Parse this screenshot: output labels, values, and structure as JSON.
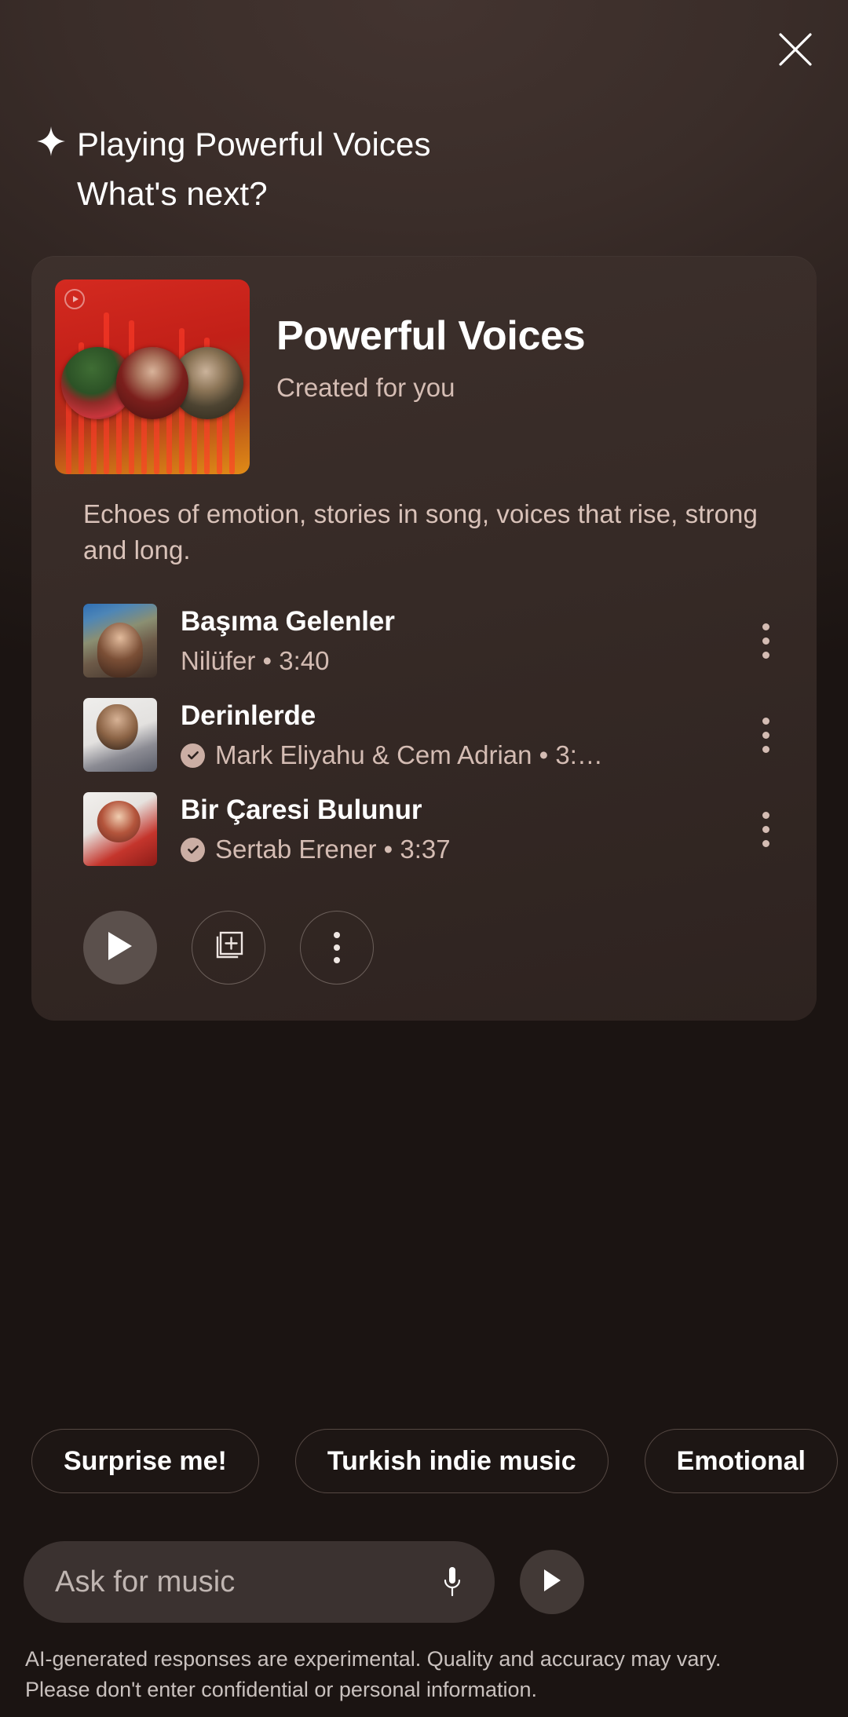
{
  "header": {
    "close_icon": "close-icon",
    "sparkle_icon": "sparkle-icon",
    "message": "Playing Powerful Voices\nWhat's next?"
  },
  "card": {
    "cover_icon": "youtube-music-badge-icon",
    "title": "Powerful Voices",
    "subtitle": "Created for you",
    "description": "Echoes of emotion, stories in song, voices that rise, strong and long.",
    "tracks": [
      {
        "title": "Başıma Gelenler",
        "artist": "Nilüfer • 3:40",
        "verified": false,
        "menu_icon": "kebab-menu-icon"
      },
      {
        "title": "Derinlerde",
        "artist": "Mark Eliyahu & Cem Adrian • 3:…",
        "verified": true,
        "menu_icon": "kebab-menu-icon"
      },
      {
        "title": "Bir Çaresi Bulunur",
        "artist": "Sertab Erener • 3:37",
        "verified": true,
        "menu_icon": "kebab-menu-icon"
      }
    ],
    "actions": [
      {
        "name": "play-button",
        "icon": "play-icon"
      },
      {
        "name": "save-to-library-button",
        "icon": "add-to-library-icon"
      },
      {
        "name": "more-options-button",
        "icon": "kebab-menu-icon"
      }
    ]
  },
  "suggestions": [
    {
      "label": "Surprise me!"
    },
    {
      "label": "Turkish indie music"
    },
    {
      "label": "Emotional"
    }
  ],
  "input": {
    "placeholder": "Ask for music",
    "mic_icon": "microphone-icon",
    "send_icon": "send-play-icon"
  },
  "disclaimer": "AI-generated responses are experimental. Quality and accuracy may vary.\nPlease don't enter confidential or personal information.",
  "colors": {
    "background": "#2e2320",
    "card": "#3a2d29",
    "accent_text": "#d4bcb3",
    "cover_red": "#c4241b",
    "cover_orange": "#e08b17"
  }
}
